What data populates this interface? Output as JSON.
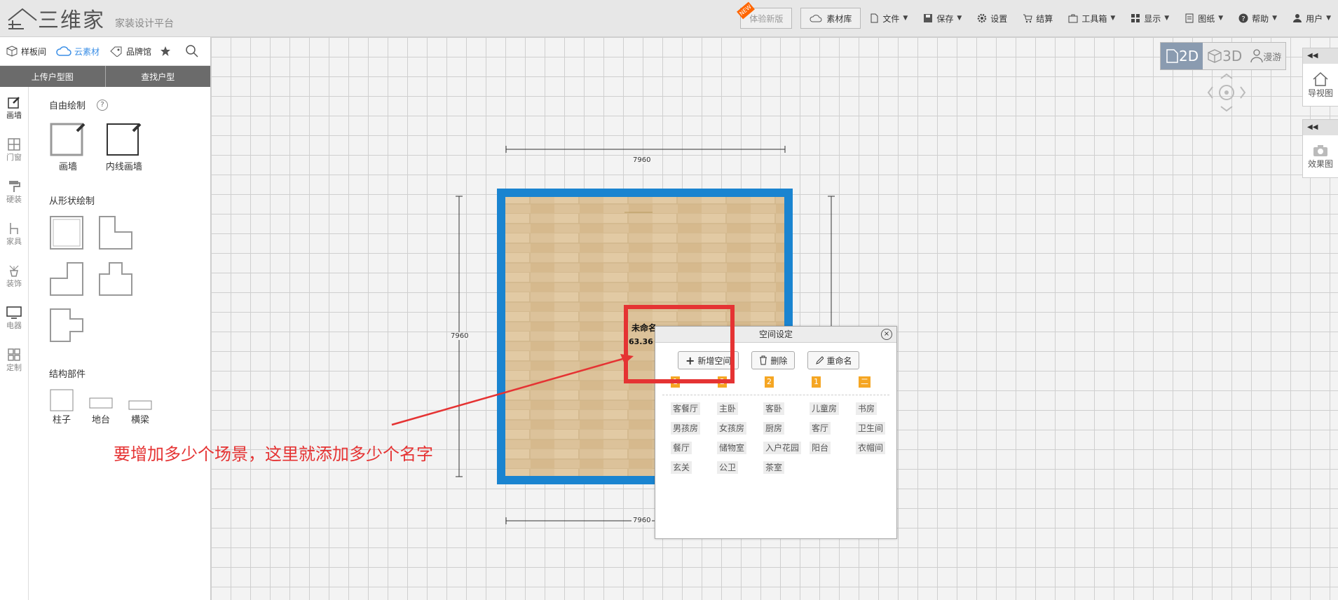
{
  "topbar": {
    "logo": "三维家",
    "subtitle": "家装设计平台",
    "new_badge": "NEW",
    "trial_button": "体验新版",
    "library_button": "素材库",
    "menu": [
      {
        "label": "文件",
        "icon": "file-icon",
        "dropdown": true
      },
      {
        "label": "保存",
        "icon": "save-icon",
        "dropdown": true
      },
      {
        "label": "设置",
        "icon": "gear-icon",
        "dropdown": false
      },
      {
        "label": "结算",
        "icon": "cart-icon",
        "dropdown": false
      },
      {
        "label": "工具箱",
        "icon": "toolbox-icon",
        "dropdown": true
      },
      {
        "label": "显示",
        "icon": "grid-icon",
        "dropdown": true
      },
      {
        "label": "图纸",
        "icon": "drawing-icon",
        "dropdown": true
      },
      {
        "label": "帮助",
        "icon": "help-icon",
        "dropdown": true
      },
      {
        "label": "用户",
        "icon": "user-icon",
        "dropdown": true
      }
    ]
  },
  "left": {
    "tabs": [
      {
        "label": "样板间",
        "icon": "cube-icon"
      },
      {
        "label": "云素材",
        "icon": "cloud-icon",
        "active": true
      },
      {
        "label": "品牌馆",
        "icon": "tag-icon"
      }
    ],
    "buttons": [
      "上传户型图",
      "查找户型"
    ],
    "side": [
      "画墙",
      "门窗",
      "硬装",
      "家具",
      "装饰",
      "电器",
      "定制"
    ],
    "free_draw_title": "自由绘制",
    "help_mark": "?",
    "tools": [
      "画墙",
      "内线画墙"
    ],
    "shape_title": "从形状绘制",
    "parts_title": "结构部件",
    "parts": [
      "柱子",
      "地台",
      "横梁"
    ]
  },
  "view": {
    "d2": "2D",
    "d3": "3D",
    "walk": "漫游"
  },
  "dock": {
    "nav": "导视图",
    "effect": "效果图"
  },
  "plan": {
    "dim": "7960",
    "room_name": "未命名",
    "room_area": "63.36"
  },
  "dialog": {
    "title": "空间设定",
    "close": "×",
    "add": "新增空间",
    "delete": "删除",
    "rename": "重命名",
    "floors": [
      "1",
      "2",
      "2",
      "1",
      "二楼"
    ],
    "rooms": [
      "客餐厅",
      "主卧",
      "客卧",
      "儿童房",
      "书房",
      "男孩房",
      "女孩房",
      "厨房",
      "客厅",
      "卫生间",
      "餐厅",
      "储物室",
      "入户花园",
      "阳台",
      "衣帽间",
      "玄关",
      "公卫",
      "茶室"
    ]
  },
  "annotation": "要增加多少个场景，这里就添加多少个名字",
  "colors": {
    "accent": "#3a8ee6",
    "wall": "#1a84d0",
    "floor_tag": "#f5a623",
    "annot": "#e53333"
  }
}
